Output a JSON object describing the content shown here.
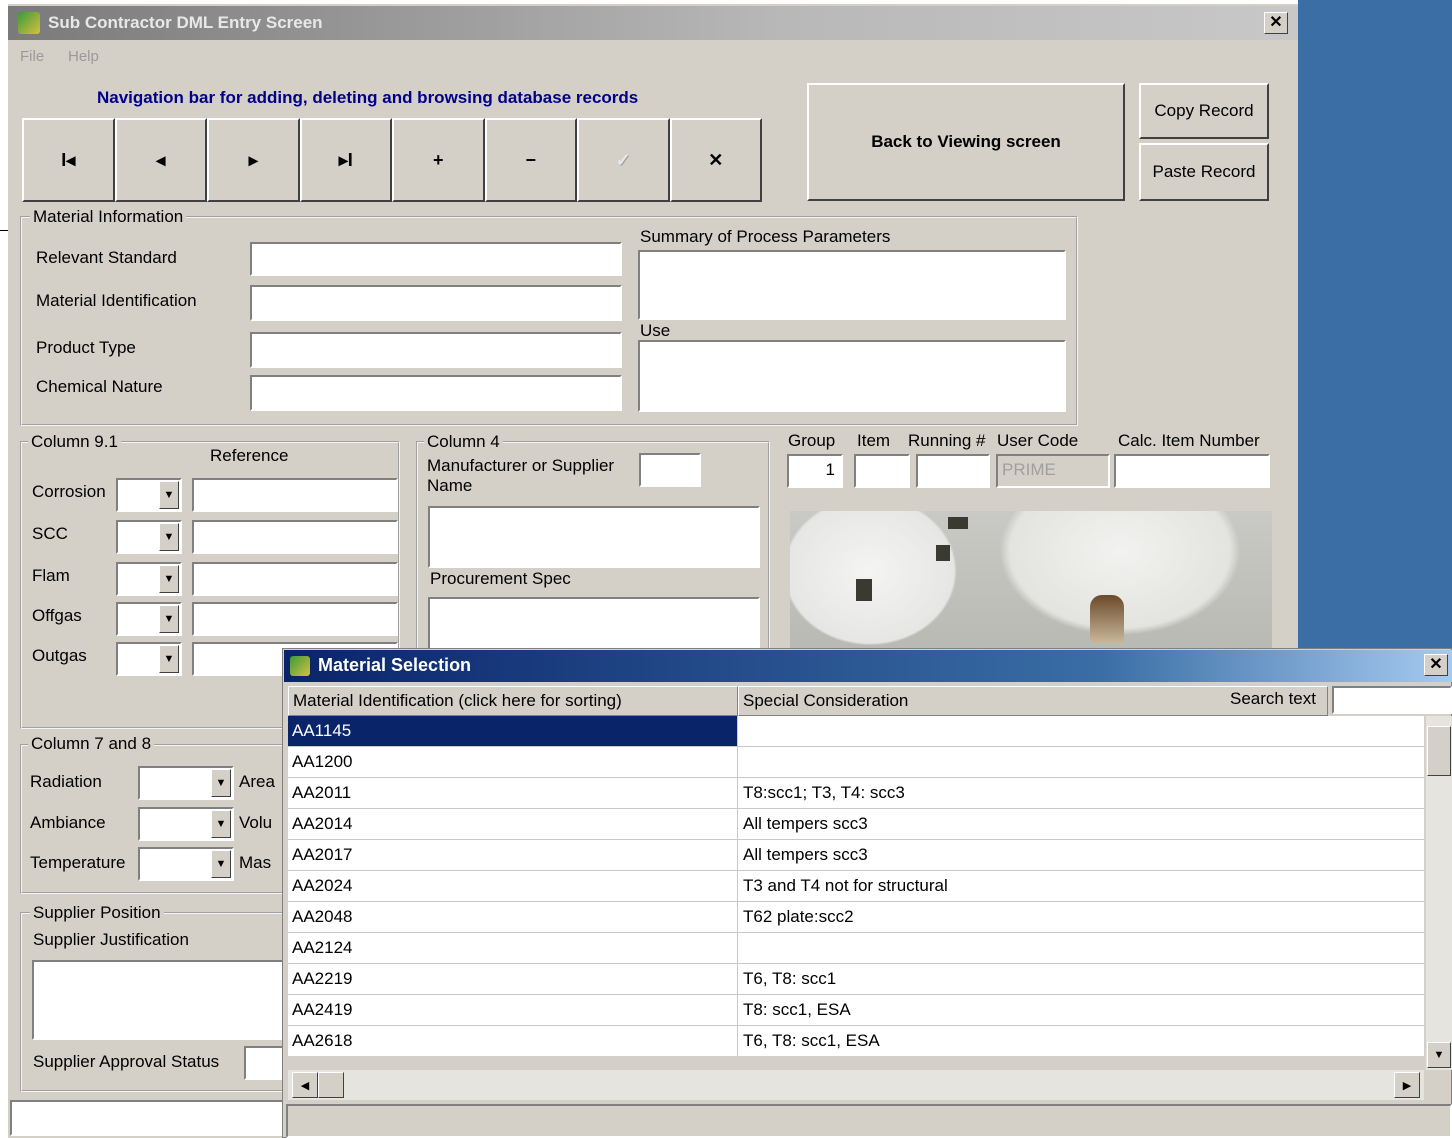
{
  "window": {
    "title": "Sub Contractor DML Entry Screen",
    "close_glyph": "✕"
  },
  "menu": [
    "File",
    "Help"
  ],
  "navbar": {
    "label": "Navigation bar for adding, deleting and browsing database records",
    "buttons": [
      {
        "name": "first-record-button",
        "glyph": "I◂",
        "icon": "first-icon"
      },
      {
        "name": "previous-record-button",
        "glyph": "◂",
        "icon": "prev-icon"
      },
      {
        "name": "next-record-button",
        "glyph": "▸",
        "icon": "next-icon"
      },
      {
        "name": "last-record-button",
        "glyph": "▸I",
        "icon": "last-icon"
      },
      {
        "name": "add-record-button",
        "glyph": "+",
        "icon": "plus-icon"
      },
      {
        "name": "delete-record-button",
        "glyph": "−",
        "icon": "minus-icon"
      },
      {
        "name": "post-record-button",
        "glyph": "✓",
        "icon": "check-icon",
        "disabled": true
      },
      {
        "name": "cancel-record-button",
        "glyph": "✕",
        "icon": "cancel-icon"
      }
    ]
  },
  "buttons": {
    "back": "Back to Viewing screen",
    "copy": "Copy Record",
    "paste": "Paste Record"
  },
  "material_info": {
    "group_label": "Material Information",
    "relevant_standard": "Relevant Standard",
    "material_identification": "Material Identification",
    "product_type": "Product Type",
    "chemical_nature": "Chemical Nature",
    "summary_label": "Summary of Process Parameters",
    "use_label": "Use"
  },
  "column91": {
    "group_label": "Column 9.1",
    "reference": "Reference",
    "rows": [
      "Corrosion",
      "SCC",
      "Flam",
      "Offgas",
      "Outgas"
    ]
  },
  "column4": {
    "group_label": "Column 4",
    "manufacturer": "Manufacturer or Supplier Name",
    "procurement": "Procurement Spec"
  },
  "item_fields": {
    "group": "Group",
    "item": "Item",
    "running": "Running #",
    "user_code": "User Code",
    "calc": "Calc. Item Number",
    "group_value": "1",
    "user_code_value": "PRIME"
  },
  "column78": {
    "group_label": "Column 7 and 8",
    "rows": [
      "Radiation",
      "Ambiance",
      "Temperature"
    ],
    "side": [
      "Area",
      "Volu",
      "Mas"
    ]
  },
  "supplier": {
    "group_label": "Supplier Position",
    "justification": "Supplier Justification",
    "approval": "Supplier Approval Status"
  },
  "dialog": {
    "title": "Material Selection",
    "col1": "Material Identification (click here for sorting)",
    "col2": "Special Consideration",
    "search_label": "Search text",
    "search_value": "",
    "rows": [
      {
        "id": "AA1145",
        "note": ""
      },
      {
        "id": "AA1200",
        "note": ""
      },
      {
        "id": "AA2011",
        "note": "T8:scc1; T3, T4: scc3"
      },
      {
        "id": "AA2014",
        "note": "All tempers scc3"
      },
      {
        "id": "AA2017",
        "note": "All tempers scc3"
      },
      {
        "id": "AA2024",
        "note": "T3 and T4 not for structural"
      },
      {
        "id": "AA2048",
        "note": "T62 plate:scc2"
      },
      {
        "id": "AA2124",
        "note": ""
      },
      {
        "id": "AA2219",
        "note": "T6, T8: scc1"
      },
      {
        "id": "AA2419",
        "note": "T8: scc1, ESA"
      },
      {
        "id": "AA2618",
        "note": "T6, T8: scc1, ESA"
      }
    ],
    "selected_index": 0
  },
  "colors": {
    "desktop": "#3a6ea5",
    "window": "#d4d0c8",
    "nav_label": "#00008b",
    "selection": "#0a246a"
  }
}
